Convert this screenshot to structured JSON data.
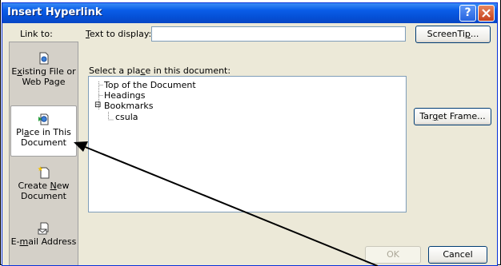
{
  "dialog": {
    "title": "Insert Hyperlink",
    "help_icon": "question-mark-icon",
    "close_icon": "close-x-icon"
  },
  "link_to": {
    "label": "Link to:",
    "items": [
      {
        "line1_pre": "",
        "line1_u": "",
        "line1_post": "",
        "line1": "Existing File or",
        "line2": "Web Page",
        "icon": "existing-file-icon",
        "u_pre": "E",
        "u": "x",
        "u_post": "isting File or"
      },
      {
        "icon": "place-in-document-icon",
        "u_pre": "Pl",
        "u": "a",
        "u_post": "ce in This",
        "line2": "Document"
      },
      {
        "icon": "create-new-document-icon",
        "u_pre": "Create ",
        "u": "N",
        "u_post": "ew",
        "line2": "Document"
      },
      {
        "icon": "email-address-icon",
        "u_pre": "E-",
        "u": "m",
        "u_post": "ail Address",
        "line2": ""
      }
    ]
  },
  "text_to_display": {
    "u": "T",
    "rest": "ext to display:",
    "value": ""
  },
  "select_place": {
    "pre": "Select a pla",
    "u": "c",
    "post": "e in this document:"
  },
  "tree": {
    "top": "Top of the Document",
    "headings": "Headings",
    "bookmarks": "Bookmarks",
    "expander": "⊟",
    "child": "csula"
  },
  "buttons": {
    "screentip_pre": "ScreenTi",
    "screentip_u": "p",
    "screentip_post": "...",
    "target_pre": "Tar",
    "target_u": "g",
    "target_post": "et Frame...",
    "ok": "OK",
    "cancel": "Cancel"
  },
  "colors": {
    "titlebar": "#0A5DE8",
    "dialog_bg": "#ECE9D8",
    "arrow": "#000000"
  }
}
